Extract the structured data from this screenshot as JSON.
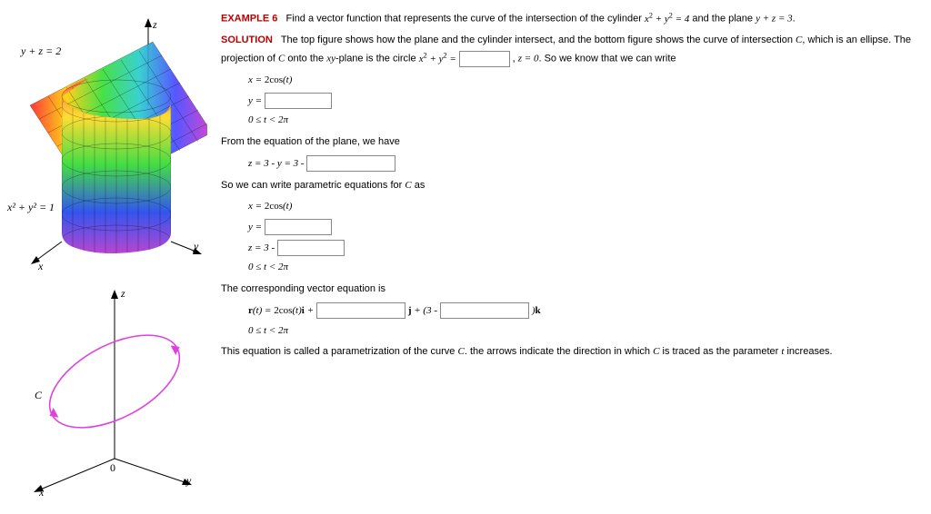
{
  "fig1": {
    "zlabel": "z",
    "planeLabel": "y + z = 2",
    "cylLabel": "x² + y² = 1",
    "xlabel": "x",
    "ylabel": "y"
  },
  "fig2": {
    "zlabel": "z",
    "Clabel": "C",
    "origin": "0",
    "xlabel": "x",
    "ylabel": "y"
  },
  "text": {
    "exHdr": "EXAMPLE 6",
    "exBody1": "Find a vector function that represents the curve of the intersection of the cylinder ",
    "exEq1a": "x",
    "exEq1b": " + y",
    "exEq1c": " = 4",
    "exBody2": " and the plane ",
    "exEq2": "y + z = 3",
    "exBody3": ".",
    "solHdr": "SOLUTION",
    "sol1": "The top figure shows how the plane and the cylinder intersect, and the bottom figure shows the curve of intersection ",
    "C": "C",
    "sol2": ", which is an ellipse. The projection of ",
    "sol3": " onto the ",
    "xy": "xy",
    "sol4": "-plane is the circle ",
    "circEq1": "x",
    "circEq2": " + y",
    "circEq3": " = ",
    "sol5": ", ",
    "zeq": "z = 0",
    "sol6": ". So we know that we can write",
    "paramX1a": "x = ",
    "paramX1b": "2cos",
    "paramX1c": "(t)",
    "paramY": "y = ",
    "range": "0 ≤ t < 2π",
    "planeText": "From the equation of the plane, we have",
    "zPlane1": "z = 3 - y = 3 - ",
    "paramText": "So we can write parametric equations for ",
    "paramText2": " as",
    "zParam": "z = 3 - ",
    "vecText": "The corresponding vector equation is",
    "r": "r",
    "vecEq1a": "(t) = ",
    "vecEq1b": "2cos",
    "vecEq1c": "(t)",
    "ib": "i",
    "plus": " + ",
    "jb": "j",
    "plus3": " + (3 - ",
    "close": ")",
    "kb": "k",
    "finalText1": "This equation is called a parametrization of the curve ",
    "finalText2": ". the arrows indicate the direction in which ",
    "finalText3": " is traced as the parameter ",
    "tvar": "t",
    "finalText4": " increases."
  }
}
